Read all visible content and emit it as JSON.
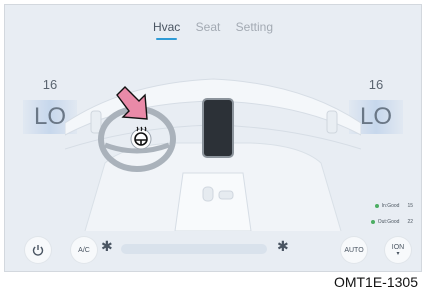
{
  "tabs": {
    "hvac": "Hvac",
    "seat": "Seat",
    "setting": "Setting"
  },
  "left_zone": {
    "temp": "16",
    "mode": "LO"
  },
  "right_zone": {
    "temp": "16",
    "mode": "LO"
  },
  "air_quality": {
    "in_label": "In:Good",
    "in_value": "15",
    "out_label": "Out:Good",
    "out_value": "22",
    "status_color": "#4cae63"
  },
  "controls": {
    "ac_label": "A/C",
    "auto_label": "AUTO",
    "ion_label": "ION"
  },
  "icons": [
    "power-icon",
    "fan-low-icon",
    "fan-high-icon",
    "ion-icon",
    "steering-wheel-heat-icon",
    "callout-arrow-icon"
  ],
  "caption": "OMT1E-1305",
  "colors": {
    "accent": "#2f9bd6",
    "arrow": "#e98aa8"
  }
}
